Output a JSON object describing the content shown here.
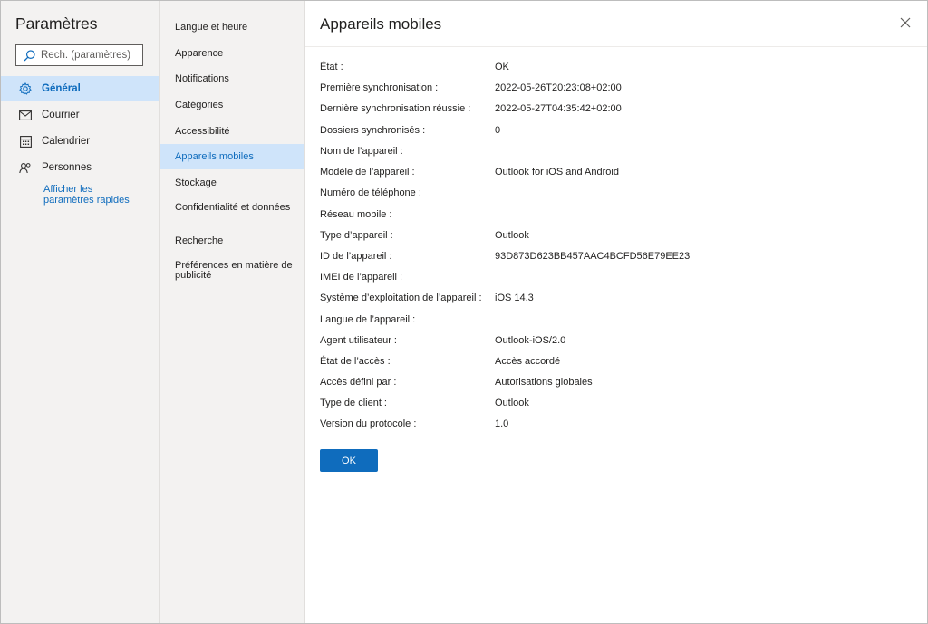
{
  "left_nav": {
    "title": "Paramètres",
    "search_placeholder": "Rech. (paramètres)",
    "items": [
      {
        "label": "Général",
        "icon": "gear-icon",
        "active": true
      },
      {
        "label": "Courrier",
        "icon": "mail-icon",
        "active": false
      },
      {
        "label": "Calendrier",
        "icon": "calendar-icon",
        "active": false
      },
      {
        "label": "Personnes",
        "icon": "people-icon",
        "active": false
      }
    ],
    "quick_settings_link": "Afficher les paramètres rapides"
  },
  "sub_nav": {
    "items": [
      {
        "label": "Langue et heure",
        "active": false
      },
      {
        "label": "Apparence",
        "active": false
      },
      {
        "label": "Notifications",
        "active": false
      },
      {
        "label": "Catégories",
        "active": false
      },
      {
        "label": "Accessibilité",
        "active": false
      },
      {
        "label": "Appareils mobiles",
        "active": true
      },
      {
        "label": "Stockage",
        "active": false
      },
      {
        "label": "Confidentialité et données",
        "active": false
      },
      {
        "label": "Recherche",
        "active": false
      },
      {
        "label": "Préférences en matière de publicité",
        "active": false
      }
    ]
  },
  "main": {
    "title": "Appareils mobiles",
    "close_icon": "close-icon",
    "details": [
      {
        "label": "État :",
        "value": "OK"
      },
      {
        "label": "Première synchronisation :",
        "value": "2022-05-26T20:23:08+02:00"
      },
      {
        "label": "Dernière synchronisation réussie :",
        "value": "2022-05-27T04:35:42+02:00"
      },
      {
        "label": "Dossiers synchronisés :",
        "value": "0"
      },
      {
        "label": "Nom de l’appareil :",
        "value": ""
      },
      {
        "label": "Modèle de l’appareil :",
        "value": "Outlook for iOS and Android"
      },
      {
        "label": "Numéro de téléphone :",
        "value": ""
      },
      {
        "label": "Réseau mobile :",
        "value": ""
      },
      {
        "label": "Type d’appareil :",
        "value": "Outlook"
      },
      {
        "label": "ID de l’appareil :",
        "value": "93D873D623BB457AAC4BCFD56E79EE23"
      },
      {
        "label": "IMEI de l’appareil :",
        "value": ""
      },
      {
        "label": "Système d’exploitation de l’appareil :",
        "value": "iOS 14.3"
      },
      {
        "label": "Langue de l’appareil :",
        "value": ""
      },
      {
        "label": "Agent utilisateur :",
        "value": "Outlook-iOS/2.0"
      },
      {
        "label": "État de l’accès :",
        "value": "Accès accordé"
      },
      {
        "label": "Accès défini par :",
        "value": "Autorisations globales"
      },
      {
        "label": "Type de client :",
        "value": "Outlook"
      },
      {
        "label": "Version du protocole :",
        "value": "1.0"
      }
    ],
    "ok_label": "OK"
  },
  "colors": {
    "accent": "#0f6cbd",
    "selected_bg": "#cfe4fa",
    "nav_bg": "#f3f2f1"
  }
}
